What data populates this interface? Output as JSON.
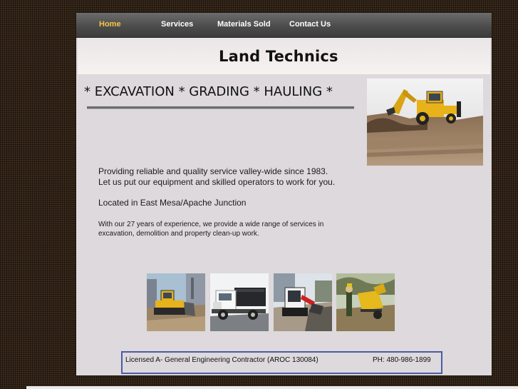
{
  "nav": {
    "items": [
      {
        "label": "Home",
        "active": true
      },
      {
        "label": "Services",
        "active": false
      },
      {
        "label": "Materials Sold",
        "active": false
      },
      {
        "label": "Contact  Us",
        "active": false
      }
    ]
  },
  "header": {
    "title": "Land Technics"
  },
  "main": {
    "headline": "* EXCAVATION * GRADING * HAULING *",
    "intro_line1": "Providing reliable and quality service valley-wide since 1983.",
    "intro_line2": "Let us put our equipment and skilled operators to work for you.",
    "location": "Located in East Mesa/Apache Junction",
    "experience": "With our 27 years of experience, we provide a wide range of services in excavation, demolition and property clean-up work."
  },
  "images": {
    "main": "backhoe-loader-photo",
    "thumbs": [
      "bulldozer-photo",
      "dump-truck-photo",
      "skid-steer-photo",
      "wood-chipper-photo"
    ]
  },
  "footer": {
    "license": "Licensed A- General Engineering Contractor (AROC 130084)",
    "phone": "PH: 480-986-1899"
  },
  "colors": {
    "background": "#3a2a1c",
    "content": "#ddd9dc",
    "nav_active": "#f5c542",
    "box_border": "#4b5aa6"
  }
}
